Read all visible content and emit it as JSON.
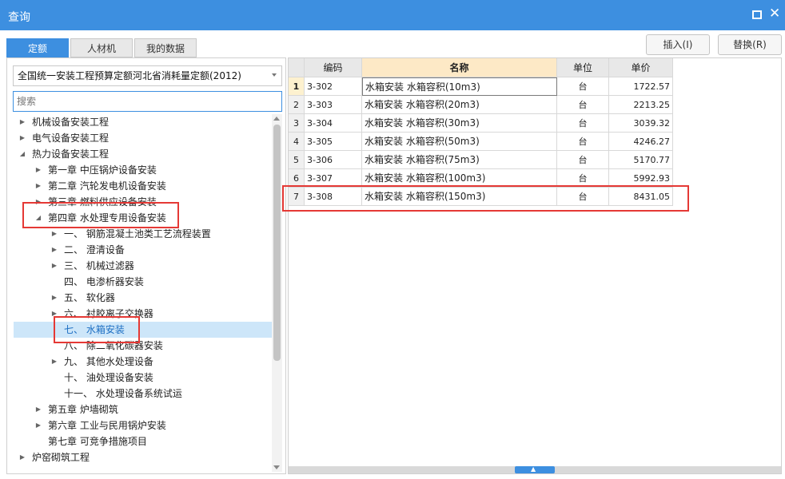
{
  "window": {
    "title": "查询"
  },
  "tabs": [
    {
      "label": "定额",
      "active": true
    },
    {
      "label": "人材机",
      "active": false
    },
    {
      "label": "我的数据",
      "active": false
    }
  ],
  "buttons": {
    "insert": "插入(I)",
    "replace": "替换(R)"
  },
  "library_select": {
    "value": "全国统一安装工程预算定额河北省消耗量定额(2012)"
  },
  "search": {
    "placeholder": "搜索"
  },
  "tree": [
    {
      "label": "机械设备安装工程",
      "level": 0,
      "toggle": "collapsed"
    },
    {
      "label": "电气设备安装工程",
      "level": 0,
      "toggle": "collapsed"
    },
    {
      "label": "热力设备安装工程",
      "level": 0,
      "toggle": "expanded"
    },
    {
      "label": "第一章 中压锅炉设备安装",
      "level": 1,
      "toggle": "collapsed"
    },
    {
      "label": "第二章 汽轮发电机设备安装",
      "level": 1,
      "toggle": "collapsed"
    },
    {
      "label": "第三章 燃料供应设备安装",
      "level": 1,
      "toggle": "collapsed"
    },
    {
      "label": "第四章 水处理专用设备安装",
      "level": 1,
      "toggle": "expanded"
    },
    {
      "label": "一、  钢筋混凝土池类工艺流程装置",
      "level": 2,
      "toggle": "collapsed"
    },
    {
      "label": "二、  澄清设备",
      "level": 2,
      "toggle": "collapsed"
    },
    {
      "label": "三、  机械过滤器",
      "level": 2,
      "toggle": "collapsed"
    },
    {
      "label": "四、  电渗析器安装",
      "level": 2,
      "toggle": "none"
    },
    {
      "label": "五、  软化器",
      "level": 2,
      "toggle": "collapsed"
    },
    {
      "label": "六、  衬胶离子交换器",
      "level": 2,
      "toggle": "collapsed"
    },
    {
      "label": "七、  水箱安装",
      "level": 2,
      "toggle": "none",
      "selected": true
    },
    {
      "label": "八、  除二氧化碳器安装",
      "level": 2,
      "toggle": "none"
    },
    {
      "label": "九、  其他水处理设备",
      "level": 2,
      "toggle": "collapsed"
    },
    {
      "label": "十、  油处理设备安装",
      "level": 2,
      "toggle": "none"
    },
    {
      "label": "十一、  水处理设备系统试运",
      "level": 2,
      "toggle": "none"
    },
    {
      "label": "第五章 炉墙砌筑",
      "level": 1,
      "toggle": "collapsed"
    },
    {
      "label": "第六章 工业与民用锅炉安装",
      "level": 1,
      "toggle": "collapsed"
    },
    {
      "label": "第七章 可竞争措施项目",
      "level": 1,
      "toggle": "none"
    },
    {
      "label": "炉窑砌筑工程",
      "level": 0,
      "toggle": "collapsed"
    }
  ],
  "table": {
    "columns": [
      "编码",
      "名称",
      "单位",
      "单价"
    ],
    "rows": [
      {
        "num": "1",
        "code": "3-302",
        "name": "水箱安装 水箱容积(10m3)",
        "unit": "台",
        "price": "1722.57"
      },
      {
        "num": "2",
        "code": "3-303",
        "name": "水箱安装 水箱容积(20m3)",
        "unit": "台",
        "price": "2213.25"
      },
      {
        "num": "3",
        "code": "3-304",
        "name": "水箱安装 水箱容积(30m3)",
        "unit": "台",
        "price": "3039.32"
      },
      {
        "num": "4",
        "code": "3-305",
        "name": "水箱安装 水箱容积(50m3)",
        "unit": "台",
        "price": "4246.27"
      },
      {
        "num": "5",
        "code": "3-306",
        "name": "水箱安装 水箱容积(75m3)",
        "unit": "台",
        "price": "5170.77"
      },
      {
        "num": "6",
        "code": "3-307",
        "name": "水箱安装 水箱容积(100m3)",
        "unit": "台",
        "price": "5992.93"
      },
      {
        "num": "7",
        "code": "3-308",
        "name": "水箱安装 水箱容积(150m3)",
        "unit": "台",
        "price": "8431.05"
      }
    ]
  },
  "colors": {
    "accent": "#3d8fe0",
    "highlight_box": "#e53935",
    "selected_row": "#cde6f9"
  }
}
